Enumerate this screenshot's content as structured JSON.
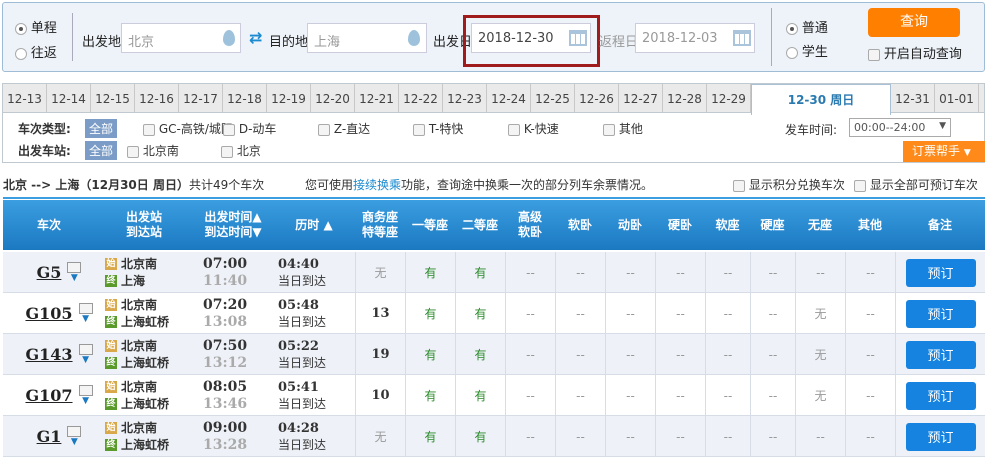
{
  "search": {
    "trip_types": [
      "单程",
      "往返"
    ],
    "from_label": "出发地",
    "from_value": "北京",
    "to_label": "目的地",
    "to_value": "上海",
    "depart_label": "出发日",
    "depart_value": "2018-12-30",
    "return_label": "返程日",
    "return_value": "2018-12-03",
    "passenger_types": [
      "普通",
      "学生"
    ],
    "query_button": "查询",
    "auto_query": "开启自动查询"
  },
  "dates": [
    "12-13",
    "12-14",
    "12-15",
    "12-16",
    "12-17",
    "12-18",
    "12-19",
    "12-20",
    "12-21",
    "12-22",
    "12-23",
    "12-24",
    "12-25",
    "12-26",
    "12-27",
    "12-28",
    "12-29",
    "12-30 周日",
    "12-31",
    "01-01"
  ],
  "filters": {
    "type_label": "车次类型:",
    "all": "全部",
    "types": [
      "GC-高铁/城际",
      "D-动车",
      "Z-直达",
      "T-特快",
      "K-快速",
      "其他"
    ],
    "station_label": "出发车站:",
    "stations": [
      "北京南",
      "北京"
    ],
    "time_label": "发车时间:",
    "time_value": "00:00--24:00",
    "helper": "订票帮手"
  },
  "summary": {
    "route": "北京 --> 上海（12月30日  周日）",
    "count": "共计49个车次",
    "tip_pre": "您可使用",
    "tip_link": "接续换乘",
    "tip_post": "功能，查询途中换乘一次的部分列车余票情况。",
    "opt1": "显示积分兑换车次",
    "opt2": "显示全部可预订车次"
  },
  "table": {
    "headers": [
      "车次",
      "出发站\n到达站",
      "出发时间▲\n到达时间▼",
      "历时 ▲",
      "商务座\n特等座",
      "一等座",
      "二等座",
      "高级\n软卧",
      "软卧",
      "动卧",
      "硬卧",
      "软座",
      "硬座",
      "无座",
      "其他",
      "备注"
    ],
    "start_badge": "始",
    "end_badge": "终",
    "book_label": "预订",
    "rows": [
      {
        "train": "G5",
        "from": "北京南",
        "to": "上海",
        "dep": "07:00",
        "arr": "11:40",
        "dur": "04:40",
        "arrive_day": "当日到达",
        "seats": [
          "无",
          "有",
          "有",
          "--",
          "--",
          "--",
          "--",
          "--",
          "--",
          "--",
          "--"
        ]
      },
      {
        "train": "G105",
        "from": "北京南",
        "to": "上海虹桥",
        "dep": "07:20",
        "arr": "13:08",
        "dur": "05:48",
        "arrive_day": "当日到达",
        "seats": [
          "13",
          "有",
          "有",
          "--",
          "--",
          "--",
          "--",
          "--",
          "--",
          "无",
          "--"
        ]
      },
      {
        "train": "G143",
        "from": "北京南",
        "to": "上海虹桥",
        "dep": "07:50",
        "arr": "13:12",
        "dur": "05:22",
        "arrive_day": "当日到达",
        "seats": [
          "19",
          "有",
          "有",
          "--",
          "--",
          "--",
          "--",
          "--",
          "--",
          "无",
          "--"
        ]
      },
      {
        "train": "G107",
        "from": "北京南",
        "to": "上海虹桥",
        "dep": "08:05",
        "arr": "13:46",
        "dur": "05:41",
        "arrive_day": "当日到达",
        "seats": [
          "10",
          "有",
          "有",
          "--",
          "--",
          "--",
          "--",
          "--",
          "--",
          "无",
          "--"
        ]
      },
      {
        "train": "G1",
        "from": "北京南",
        "to": "上海虹桥",
        "dep": "09:00",
        "arr": "13:28",
        "dur": "04:28",
        "arrive_day": "当日到达",
        "seats": [
          "无",
          "有",
          "有",
          "--",
          "--",
          "--",
          "--",
          "--",
          "--",
          "--",
          "--"
        ]
      }
    ]
  },
  "colors": {
    "accent": "#ff7f00",
    "header": "#1b79c2",
    "available": "#2a8a2a",
    "highlight": "#a01c1c"
  }
}
